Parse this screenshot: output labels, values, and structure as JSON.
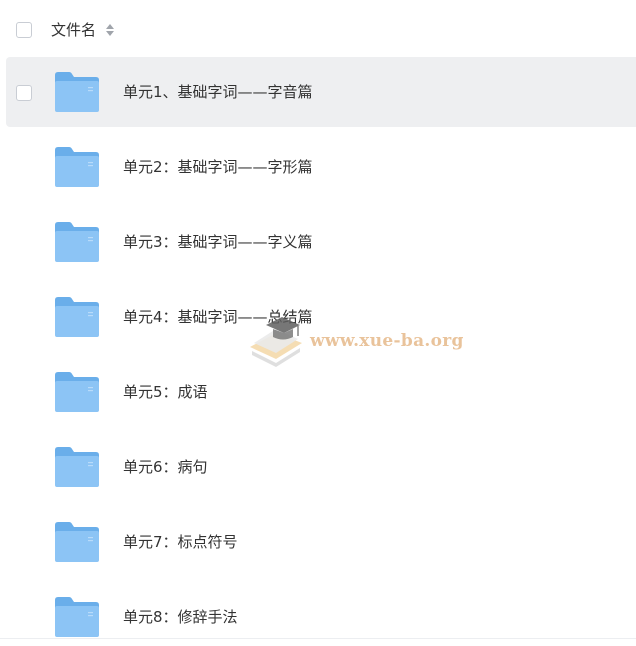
{
  "header": {
    "column_label": "文件名",
    "sort_icon": "sort-icon"
  },
  "rows": [
    {
      "label": "单元1、基础字词——字音篇",
      "icon": "folder-icon",
      "hovered": true
    },
    {
      "label": "单元2：基础字词——字形篇",
      "icon": "folder-icon"
    },
    {
      "label": "单元3：基础字词——字义篇",
      "icon": "folder-icon"
    },
    {
      "label": "单元4：基础字词——总结篇",
      "icon": "folder-icon"
    },
    {
      "label": "单元5：成语",
      "icon": "folder-icon"
    },
    {
      "label": "单元6：病句",
      "icon": "folder-icon"
    },
    {
      "label": "单元7：标点符号",
      "icon": "folder-icon"
    },
    {
      "label": "单元8：修辞手法",
      "icon": "folder-icon"
    }
  ],
  "watermark": {
    "text": "www.xue-ba.org",
    "icon": "graduation-cap-book-logo"
  },
  "colors": {
    "hover_row_bg": "#eeeff1",
    "folder_blue": "#8cc4f5",
    "folder_blue_dark": "#6aaeea",
    "text": "#333333",
    "watermark": "#e6b98a"
  }
}
